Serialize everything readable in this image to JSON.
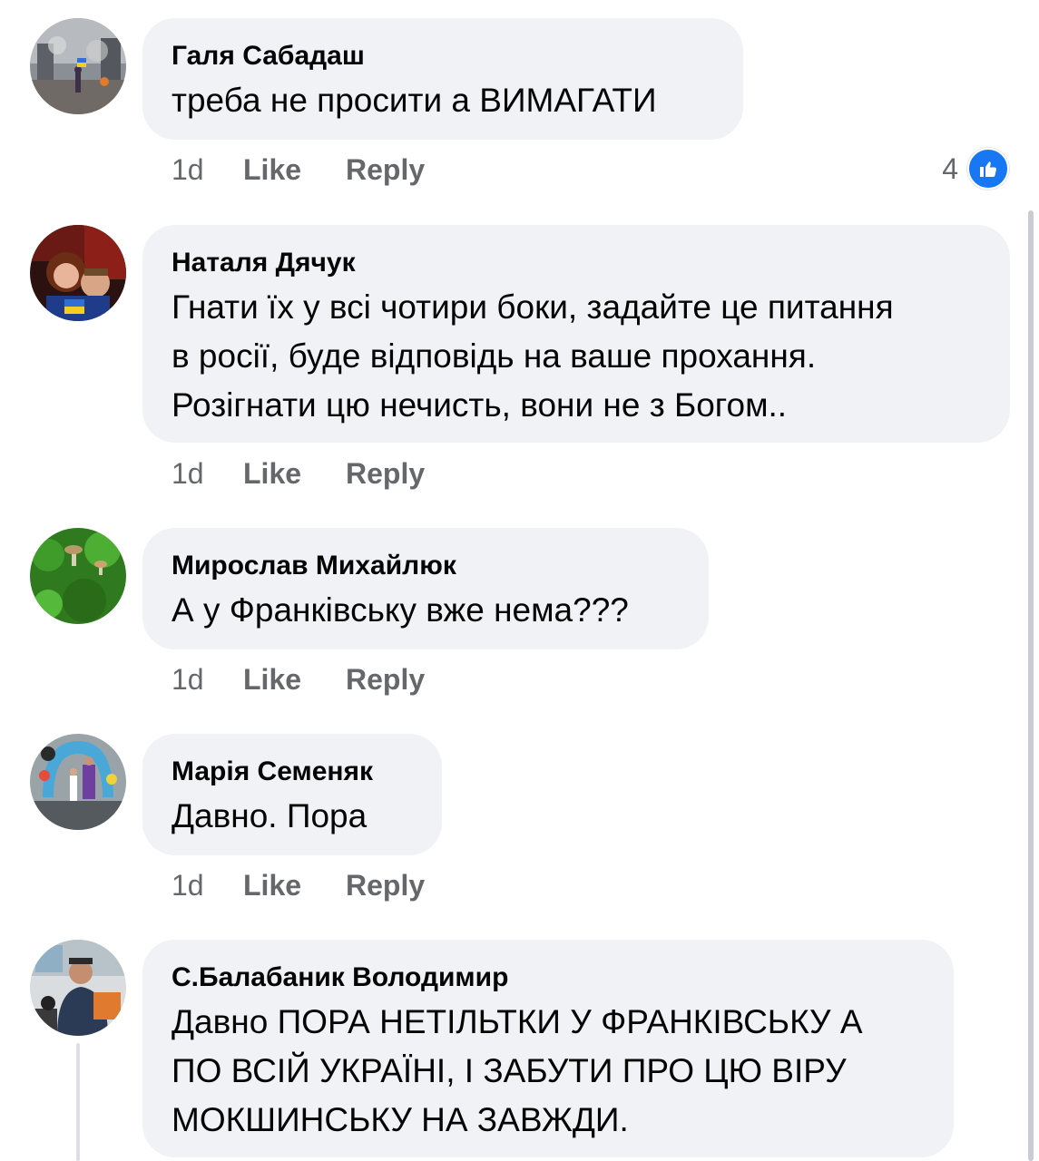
{
  "comments": [
    {
      "author": "Галя Сабадаш",
      "text": "треба не просити а ВИМАГАТИ",
      "time": "1d",
      "like_label": "Like",
      "reply_label": "Reply",
      "reaction_count": "4",
      "avatar_icon": "avatar-photo-icon"
    },
    {
      "author": "Наталя Дячук",
      "text_lines": [
        "Гнати їх у всі чотири боки, задайте це питання",
        "в росії, буде  відповідь на ваше прохання.",
        "Розігнати цю нечисть, вони не з Богом.."
      ],
      "time": "1d",
      "like_label": "Like",
      "reply_label": "Reply"
    },
    {
      "author": "Мирослав Михайлюк",
      "text": "А у Франківську вже нема???",
      "time": "1d",
      "like_label": "Like",
      "reply_label": "Reply"
    },
    {
      "author": "Марія Семеняк",
      "text": "Давно. Пора",
      "time": "1d",
      "like_label": "Like",
      "reply_label": "Reply"
    },
    {
      "author": "С.Балабаник Володимир",
      "text_lines": [
        "Давно ПОРА НЕТІЛЬТКИ У ФРАНКІВСЬКУ А",
        "ПО ВСІЙ УКРАЇНІ, І ЗАБУТИ ПРО ЦЮ ВІРУ",
        "МОКШИНСЬКУ НА ЗАВЖДИ."
      ]
    }
  ],
  "colors": {
    "bubble": "#f0f2f5",
    "secondary_text": "#65676b",
    "like_blue": "#1877f2"
  }
}
